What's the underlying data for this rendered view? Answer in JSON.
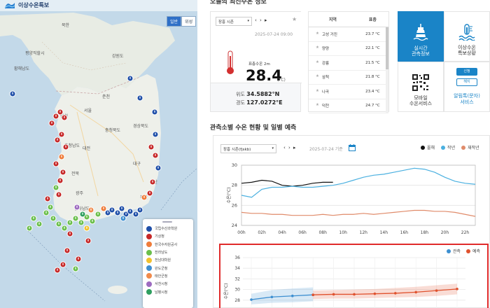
{
  "app": {
    "logo_text": "이상수온특보"
  },
  "map": {
    "toggle": {
      "map_label": "일반",
      "sat_label": "위성"
    },
    "place_labels": [
      "북한",
      "평양직할시",
      "황해남도",
      "강원도",
      "춘천",
      "서울",
      "인천",
      "충청북도",
      "대전",
      "충청남도",
      "경상북도",
      "대구",
      "전북",
      "광주",
      "부산",
      "전라남도",
      "울산"
    ],
    "legend": [
      {
        "label": "국립수산과학원",
        "color": "#1f4fa8"
      },
      {
        "label": "기상청",
        "color": "#c62828"
      },
      {
        "label": "한국수자원공사",
        "color": "#ef7c3a"
      },
      {
        "label": "전라남도",
        "color": "#6abf4b"
      },
      {
        "label": "전남대학원",
        "color": "#f2c12e"
      },
      {
        "label": "완도군청",
        "color": "#3e8ed0"
      },
      {
        "label": "태안군청",
        "color": "#f08a4b"
      },
      {
        "label": "서천시청",
        "color": "#9d6bc0"
      },
      {
        "label": "남평시청",
        "color": "#2e9e5f"
      }
    ]
  },
  "section1": {
    "title": "오늘의 최신수온 정보"
  },
  "temp_card": {
    "station": "장흥 시촌",
    "nav_arrows": "‹ › ▸",
    "date": "2025-07-24 09:00",
    "surface_label": "표층수온 2m",
    "temp": "28.4",
    "unit": "(°C)",
    "lat_label": "위도",
    "lat": "34.5882°N",
    "lon_label": "경도",
    "lon": "127.0272°E"
  },
  "region_table": {
    "headers": [
      "지역",
      "표층"
    ],
    "rows": [
      {
        "region": "고성 거진",
        "value": "23.7 °C"
      },
      {
        "region": "양양",
        "value": "22.1 °C"
      },
      {
        "region": "강릉",
        "value": "21.5 °C"
      },
      {
        "region": "삼척",
        "value": "21.8 °C"
      },
      {
        "region": "나곡",
        "value": "23.4 °C"
      },
      {
        "region": "덕천",
        "value": "24.7 °C"
      }
    ]
  },
  "tiles": {
    "realtime": "실시간\n관측정보",
    "warning": "이상수온\n특보상황",
    "mobile": "모바일\n수온서비스",
    "alarm": "알림톡(문자)\n서비스",
    "subscribe": "신청",
    "cancel": "해지"
  },
  "section2": {
    "title": "관측소별 수온 현황 및 일별 예측"
  },
  "chart_toolbar": {
    "station": "장흥 시촌(fjskb)",
    "nav": "‹ › ▸",
    "date": "2025-07-24 기준",
    "legend": [
      {
        "label": "올해",
        "color": "#111111"
      },
      {
        "label": "작년",
        "color": "#4ab0e0"
      },
      {
        "label": "재작년",
        "color": "#e08b6a"
      }
    ]
  },
  "chart_data": [
    {
      "type": "line",
      "title": "",
      "xlabel": "",
      "ylabel": "수온(°C)",
      "ylim": [
        24,
        30
      ],
      "yticks": [
        24,
        26,
        28,
        30
      ],
      "x": [
        "00h",
        "02h",
        "04h",
        "06h",
        "08h",
        "10h",
        "12h",
        "14h",
        "16h",
        "18h",
        "20h",
        "22h"
      ],
      "series": [
        {
          "name": "올해",
          "color": "#111111",
          "x": [
            0,
            1,
            2,
            3,
            4,
            5,
            6,
            7,
            8,
            9
          ],
          "values": [
            28.2,
            28.3,
            28.5,
            28.4,
            28.0,
            27.9,
            28.0,
            28.2,
            28.3,
            28.3
          ]
        },
        {
          "name": "작년",
          "color": "#4ab0e0",
          "x": [
            0,
            1,
            2,
            3,
            4,
            5,
            6,
            7,
            8,
            9,
            10,
            11,
            12,
            13,
            14,
            15,
            16,
            17,
            18,
            19,
            20,
            21,
            22,
            23
          ],
          "values": [
            27.0,
            26.8,
            27.6,
            27.8,
            27.8,
            27.9,
            27.8,
            27.8,
            27.9,
            28.0,
            28.2,
            28.5,
            28.8,
            29.0,
            29.1,
            29.3,
            29.5,
            29.7,
            29.6,
            29.3,
            28.8,
            28.4,
            28.2,
            28.1
          ]
        },
        {
          "name": "재작년",
          "color": "#e08b6a",
          "x": [
            0,
            1,
            2,
            3,
            4,
            5,
            6,
            7,
            8,
            9,
            10,
            11,
            12,
            13,
            14,
            15,
            16,
            17,
            18,
            19,
            20,
            21,
            22,
            23
          ],
          "values": [
            25.3,
            25.2,
            25.2,
            25.1,
            25.1,
            25.0,
            25.0,
            25.0,
            25.1,
            25.0,
            25.1,
            25.1,
            25.2,
            25.1,
            25.2,
            25.3,
            25.4,
            25.5,
            25.5,
            25.4,
            25.4,
            25.3,
            25.1,
            24.9
          ]
        }
      ]
    },
    {
      "type": "line",
      "title": "",
      "xlabel": "",
      "ylabel": "수온(°C)",
      "ylim": [
        26,
        36
      ],
      "yticks": [
        26,
        28,
        30,
        32,
        34,
        36
      ],
      "series": [
        {
          "name": "관측",
          "color": "#3d8fd1",
          "x": [
            0,
            1,
            2,
            3
          ],
          "values": [
            28.1,
            28.6,
            28.8,
            29.0
          ],
          "band_upper": [
            29.2,
            29.9,
            30.2,
            30.4
          ],
          "band_lower": [
            27.2,
            27.5,
            27.6,
            27.8
          ]
        },
        {
          "name": "예측",
          "color": "#e0522e",
          "x": [
            3,
            4,
            5,
            6,
            7,
            8,
            9,
            10
          ],
          "values": [
            29.0,
            29.1,
            29.1,
            29.2,
            29.3,
            29.5,
            29.8,
            30.1
          ],
          "band_upper": [
            29.8,
            29.9,
            30.0,
            30.1,
            30.3,
            30.5,
            30.8,
            31.1
          ],
          "band_lower": [
            28.2,
            28.3,
            28.3,
            28.4,
            28.5,
            28.6,
            28.8,
            29.1
          ]
        }
      ]
    }
  ]
}
